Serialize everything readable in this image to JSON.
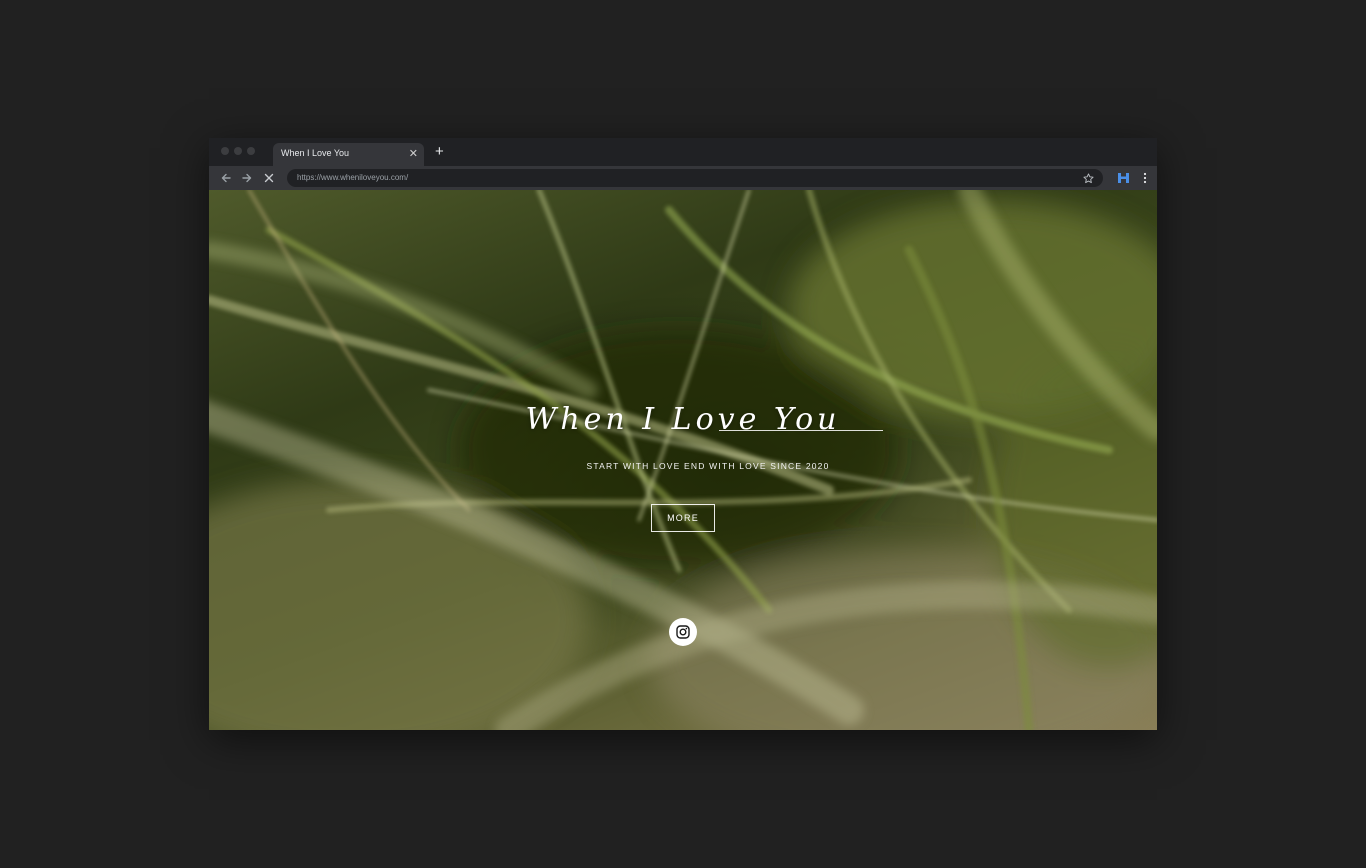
{
  "browser": {
    "tab_title": "When I Love You",
    "tab_close": "✕",
    "new_tab": "+",
    "url": "https://www.wheniloveyou.com/"
  },
  "icons": {
    "back": "arrow-left-icon",
    "forward": "arrow-right-icon",
    "stop": "close-icon",
    "bookmark": "star-icon",
    "extension": "h-extension-icon",
    "menu": "kebab-menu-icon",
    "social": "instagram-icon"
  },
  "colors": {
    "extension_icon": "#4a8fe7",
    "page_bg": "#212121"
  },
  "hero": {
    "title": "When I Love You",
    "tagline": "START WITH LOVE END WITH LOVE SINCE 2020",
    "more_label": "MORE"
  }
}
